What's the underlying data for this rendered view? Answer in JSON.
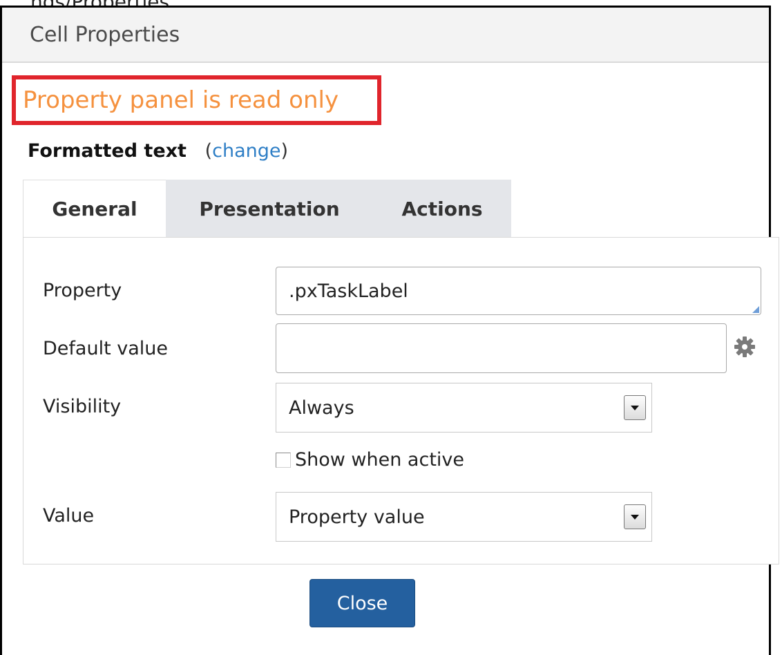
{
  "cut_text": "ngs/Properties",
  "dialog": {
    "title": "Cell Properties",
    "readonly_message": "Property panel is read only",
    "control_type": "Formatted text",
    "change_open": "(",
    "change_link": "change",
    "change_close": ")"
  },
  "tabs": [
    {
      "label": "General",
      "active": true
    },
    {
      "label": "Presentation",
      "active": false
    },
    {
      "label": "Actions",
      "active": false
    }
  ],
  "general": {
    "property": {
      "label": "Property",
      "value": ".pxTaskLabel"
    },
    "default_value": {
      "label": "Default value",
      "value": ""
    },
    "visibility": {
      "label": "Visibility",
      "selected": "Always"
    },
    "show_when_active": {
      "label": "Show when active",
      "checked": false
    },
    "value": {
      "label": "Value",
      "selected": "Property value"
    }
  },
  "footer": {
    "close_label": "Close"
  },
  "colors": {
    "readonly_text": "#f5913e",
    "highlight_border": "#e0252c",
    "link": "#2f7fc6",
    "primary_button": "#24609f"
  },
  "icons": {
    "gear": "gear-icon",
    "dropdown": "chevron-down-icon"
  }
}
